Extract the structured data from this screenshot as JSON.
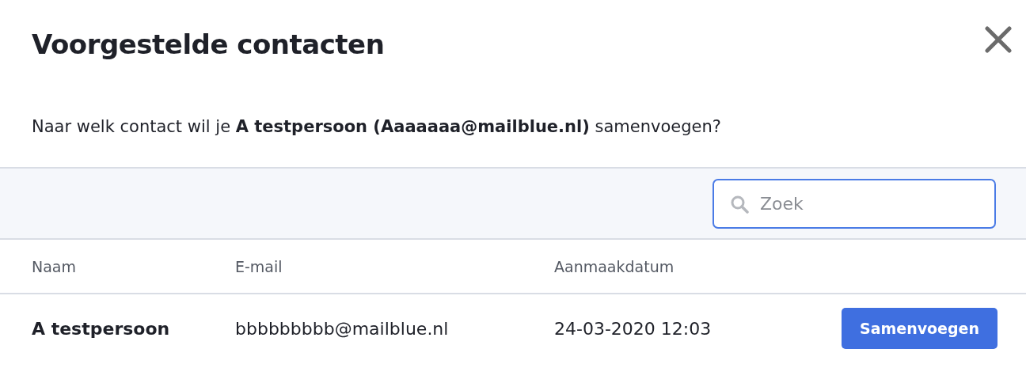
{
  "dialog": {
    "title": "Voorgestelde contacten"
  },
  "message": "Naar welk contact wil je **A testpersoon (Aaaaaaa@mailblue.nl)** samenvoegen?",
  "search": {
    "placeholder": "Zoek"
  },
  "table": {
    "columns": [
      "Naam",
      "E-mail",
      "Aanmaakdatum"
    ],
    "rows": [
      {
        "name": "A testpersoon",
        "email": "bbbbbbbbb@mailblue.nl",
        "created": "24-03-2020 12:03",
        "action": "Samenvoegen"
      }
    ]
  }
}
